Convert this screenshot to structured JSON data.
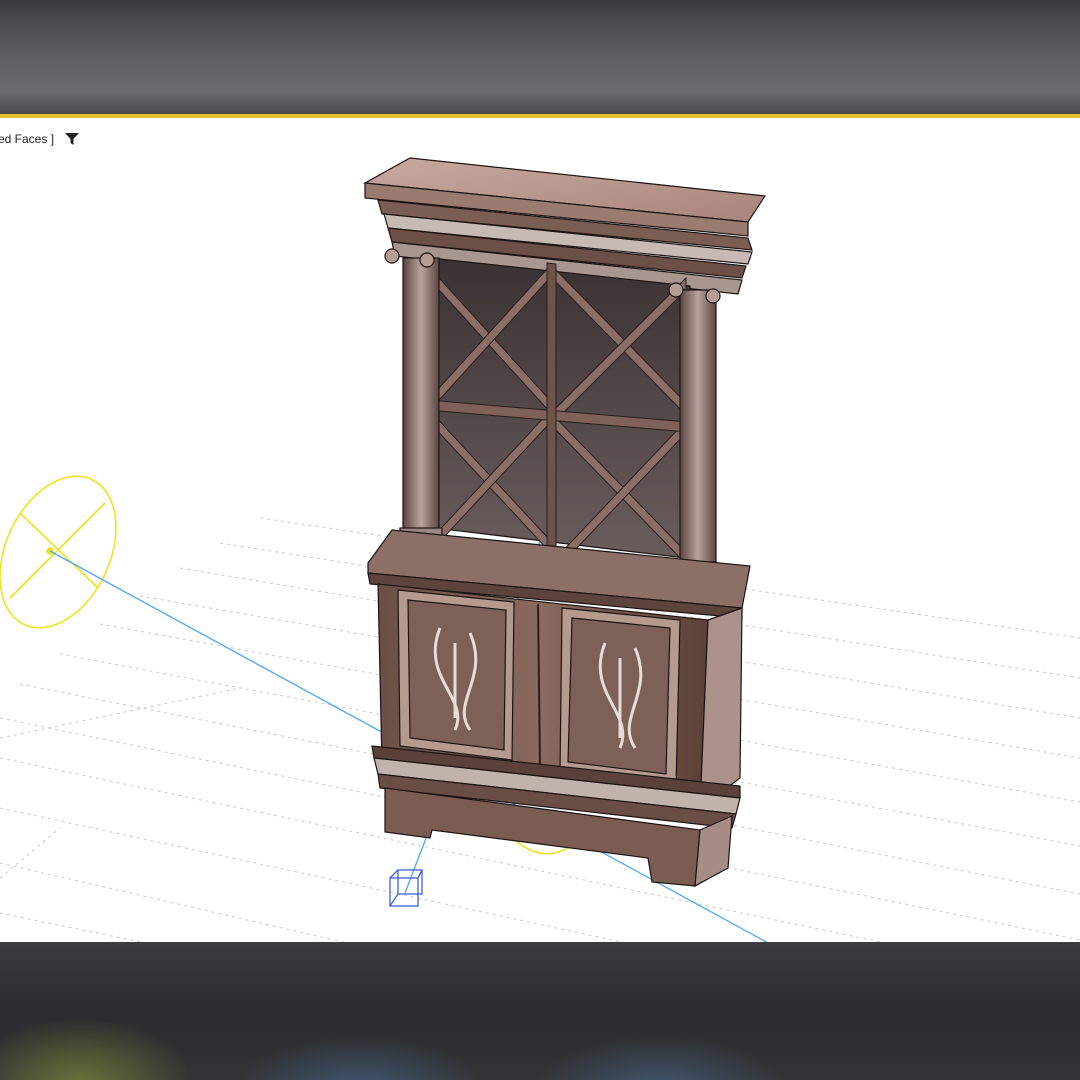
{
  "viewport": {
    "label": "ed Faces ]",
    "filter_icon": "filter-icon",
    "background": "#ffffff",
    "active_border_color": "#e5c230"
  },
  "scene": {
    "object": "wine-cabinet",
    "light_gizmo_color": "#f2e21c",
    "target_line_color": "#4aa8ff",
    "camera_gizmo_color": "#4060e0"
  }
}
